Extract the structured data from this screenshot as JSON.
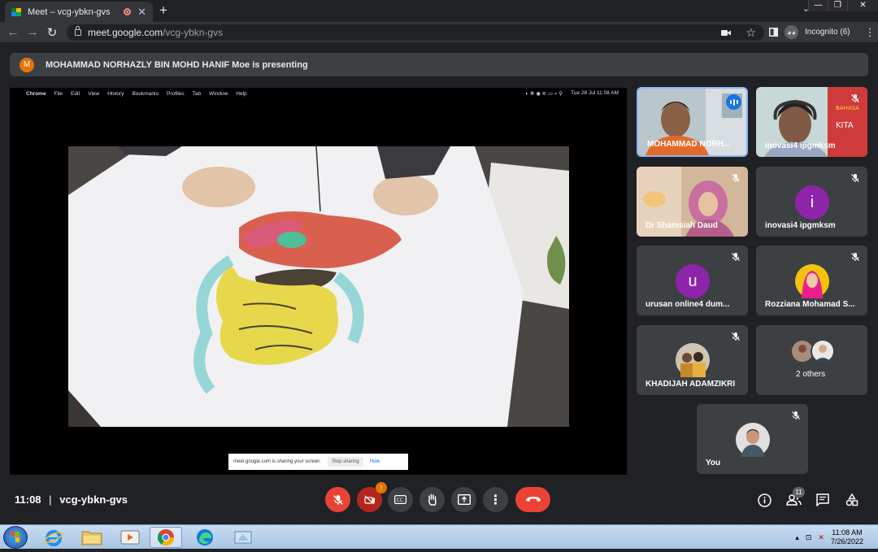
{
  "browser": {
    "tab_title": "Meet – vcg-ybkn-gvs",
    "tab_close": "✕",
    "new_tab": "+",
    "url_host": "meet.google.com",
    "url_path": "/vcg-ybkn-gvs",
    "incognito_label": "Incognito (6)",
    "window_minimize": "—",
    "window_restore": "❐",
    "window_close": "✕"
  },
  "banner": {
    "avatar_letter": "M",
    "text": "MOHAMMAD NORHAZLY BIN MOHD HANIF Moe is presenting"
  },
  "shared_screen": {
    "menu": [
      "Chrome",
      "File",
      "Edit",
      "View",
      "History",
      "Bookmarks",
      "Profiles",
      "Tab",
      "Window",
      "Help"
    ],
    "status_time": "Tue 26 Jul  11:08 AM",
    "share_notice": "meet.google.com is sharing your screen.",
    "stop_sharing": "Stop sharing",
    "hide": "Hide"
  },
  "participants": [
    {
      "name": "MOHAMMAD NORH...",
      "muted": false,
      "speaking": true
    },
    {
      "name": "inovasi4 ipgmksm",
      "muted": true
    },
    {
      "name": "Dr Shamsiah Daud",
      "muted": true
    },
    {
      "name": "inovasi4 ipgmksm",
      "muted": true,
      "letter": "i",
      "color": "#8e24aa"
    },
    {
      "name": "urusan online4 dum...",
      "muted": true,
      "letter": "u",
      "color": "#8e24aa"
    },
    {
      "name": "Rozziana Mohamad S...",
      "muted": true
    },
    {
      "name": "KHADIJAH ADAMZIKRI",
      "muted": true
    },
    {
      "name": "2 others"
    },
    {
      "name": "You",
      "muted": true
    }
  ],
  "meeting": {
    "time": "11:08",
    "separator": "|",
    "code": "vcg-ybkn-gvs",
    "camera_badge": "!",
    "people_count": "11"
  },
  "taskbar": {
    "time": "11:08 AM",
    "date": "7/26/2022"
  },
  "colors": {
    "meet_bg": "#202124",
    "tile_bg": "#3c4043",
    "danger": "#ea4335",
    "active_border": "#8ab4f8"
  }
}
